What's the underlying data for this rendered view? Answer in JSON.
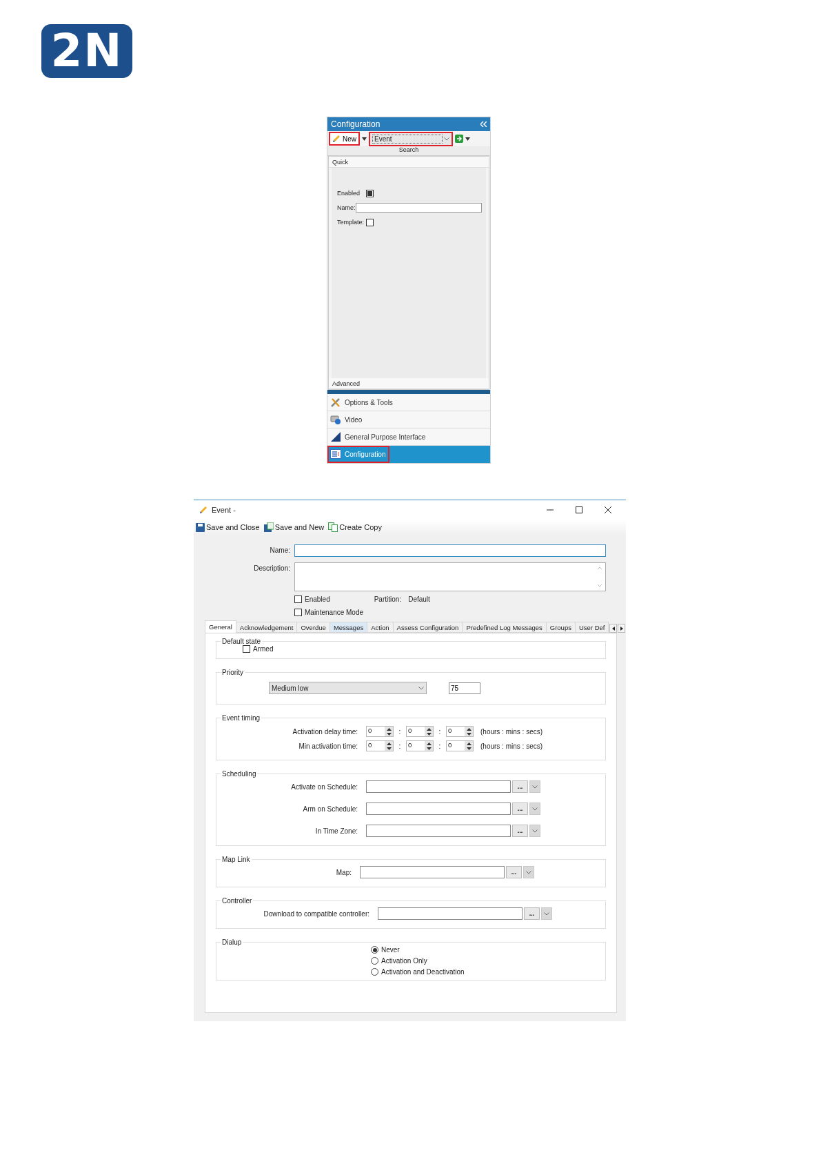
{
  "logo": {
    "text": "2N"
  },
  "config_panel": {
    "title": "Configuration",
    "new_button": {
      "label": "New",
      "highlighted": true
    },
    "type_combo": {
      "value": "Event",
      "highlighted": true
    },
    "search_label": "Search",
    "quick_label": "Quick",
    "fields": [
      {
        "kind": "checkbox",
        "label": "Enabled",
        "checked": true
      },
      {
        "kind": "text",
        "label": "Name:"
      },
      {
        "kind": "checkbox",
        "label": "Template:",
        "checked": false
      }
    ],
    "advanced_label": "Advanced",
    "nav_items": [
      {
        "label": "Options & Tools",
        "selected": false,
        "highlighted": false
      },
      {
        "label": "Video",
        "selected": false,
        "highlighted": false
      },
      {
        "label": "General Purpose Interface",
        "selected": false,
        "highlighted": false
      },
      {
        "label": "Configuration",
        "selected": true,
        "highlighted": true
      }
    ]
  },
  "event_window": {
    "title": "Event -",
    "toolbar": [
      {
        "label": "Save and Close"
      },
      {
        "label": "Save and New"
      },
      {
        "label": "Create Copy"
      }
    ],
    "name_label": "Name:",
    "description_label": "Description:",
    "enabled": {
      "label": "Enabled",
      "checked": false
    },
    "partition_label": "Partition:",
    "partition_value": "Default",
    "maintenance": {
      "label": "Maintenance Mode",
      "checked": false
    },
    "tabs": [
      {
        "label": "General",
        "selected": true,
        "hovered": false
      },
      {
        "label": "Acknowledgement",
        "selected": false,
        "hovered": false
      },
      {
        "label": "Overdue",
        "selected": false,
        "hovered": false
      },
      {
        "label": "Messages",
        "selected": false,
        "hovered": true
      },
      {
        "label": "Action",
        "selected": false,
        "hovered": false
      },
      {
        "label": "Assess Configuration",
        "selected": false,
        "hovered": false
      },
      {
        "label": "Predefined Log Messages",
        "selected": false,
        "hovered": false
      },
      {
        "label": "Groups",
        "selected": false,
        "hovered": false
      },
      {
        "label": "User Def",
        "selected": false,
        "hovered": false
      }
    ],
    "groups": [
      {
        "kind": "checkbox",
        "title": "Default state",
        "label": "Armed",
        "checked": false
      },
      {
        "kind": "select",
        "title": "Priority",
        "value": "Medium low",
        "number": "75"
      },
      {
        "kind": "timing",
        "title": "Event timing",
        "rows": [
          {
            "label": "Activation delay time:",
            "values": [
              "0",
              "0",
              "0"
            ],
            "separators": [
              ":",
              ":"
            ],
            "unit": "(hours : mins : secs)"
          },
          {
            "label": "Min activation time:",
            "values": [
              "0",
              "0",
              "0"
            ],
            "separators": [
              ":",
              ":"
            ],
            "unit": "(hours : mins : secs)"
          }
        ]
      },
      {
        "kind": "lookup",
        "title": "Scheduling",
        "rows": [
          {
            "label": "Activate on Schedule:",
            "browse": "..."
          },
          {
            "label": "Arm on Schedule:",
            "browse": "..."
          },
          {
            "label": "In Time Zone:",
            "browse": "..."
          }
        ]
      },
      {
        "kind": "lookup",
        "title": "Map Link",
        "rows": [
          {
            "label": "Map:",
            "browse": "..."
          }
        ]
      },
      {
        "kind": "lookup",
        "title": "Controller",
        "rows": [
          {
            "label": "Download to compatible controller:",
            "browse": "..."
          }
        ]
      },
      {
        "kind": "radio",
        "title": "Dialup",
        "options": [
          {
            "label": "Never",
            "selected": true
          },
          {
            "label": "Activation Only",
            "selected": false
          },
          {
            "label": "Activation and Deactivation",
            "selected": false
          }
        ]
      }
    ]
  }
}
